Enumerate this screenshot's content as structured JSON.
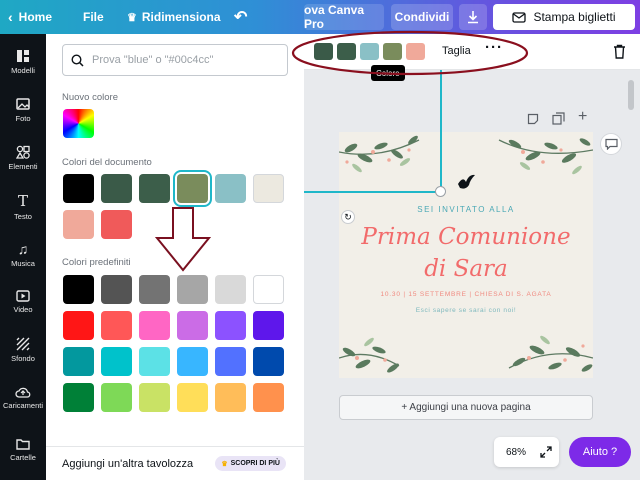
{
  "topbar": {
    "home": "Home",
    "file": "File",
    "resize": "Ridimensiona",
    "try_pro": "ova Canva Pro",
    "share": "Condividi",
    "print": "Stampa biglietti"
  },
  "rail": [
    {
      "label": "Modelli",
      "icon": "templates-icon"
    },
    {
      "label": "Foto",
      "icon": "photos-icon"
    },
    {
      "label": "Elementi",
      "icon": "elements-icon"
    },
    {
      "label": "Testo",
      "icon": "text-icon"
    },
    {
      "label": "Musica",
      "icon": "music-icon"
    },
    {
      "label": "Video",
      "icon": "video-icon"
    },
    {
      "label": "Sfondo",
      "icon": "background-icon"
    },
    {
      "label": "Caricamenti",
      "icon": "uploads-icon"
    },
    {
      "label": "Cartelle",
      "icon": "folders-icon"
    }
  ],
  "panel": {
    "search_placeholder": "Prova \"blue\" o \"#00c4cc\"",
    "new_color_title": "Nuovo colore",
    "document_colors_title": "Colori del documento",
    "document_colors": [
      "#000000",
      "#3a5a48",
      "#3c5e4a",
      "#7a8c5c",
      "#8ac0c6",
      "#ece9e0",
      "#f0a99a",
      "#f05a5a"
    ],
    "default_colors_title": "Colori predefiniti",
    "default_colors": [
      "#000000",
      "#545454",
      "#737373",
      "#a6a6a6",
      "#d9d9d9",
      "#ffffff",
      "#ff1616",
      "#ff5757",
      "#ff66c4",
      "#cb6ce6",
      "#8c52ff",
      "#5e17eb",
      "#03989e",
      "#00c2cb",
      "#5ce1e6",
      "#38b6ff",
      "#5271ff",
      "#004aad",
      "#008037",
      "#7ed957",
      "#c9e265",
      "#ffde59",
      "#ffbd59",
      "#ff914d"
    ],
    "add_board": "Aggiungi un'altra tavolozza",
    "discover_badge": "SCOPRI DI PIÙ"
  },
  "context_bar": {
    "swatches": [
      "#3a5a48",
      "#3c5e4a",
      "#8ac0c6",
      "#7a8c5c",
      "#f0a99a"
    ],
    "tooltip": "Colore",
    "crop": "Taglia"
  },
  "design": {
    "invited": "SEI INVITATO ALLA",
    "title_line1": "Prima Comunione",
    "title_line2": "di Sara",
    "details": "10.30 | 15 SETTEMBRE | CHIESA DI S. AGATA",
    "subtext": "Esci sapere se sarai con noi!"
  },
  "add_page": "+ Aggiungi una nuova pagina",
  "zoom": "68%",
  "help": "Aiuto ?",
  "colors": {
    "accent": "#7d2ae8",
    "annotation": "#8a0f1e",
    "guide": "#1fb7c9",
    "title_pink": "#f26b6b"
  }
}
